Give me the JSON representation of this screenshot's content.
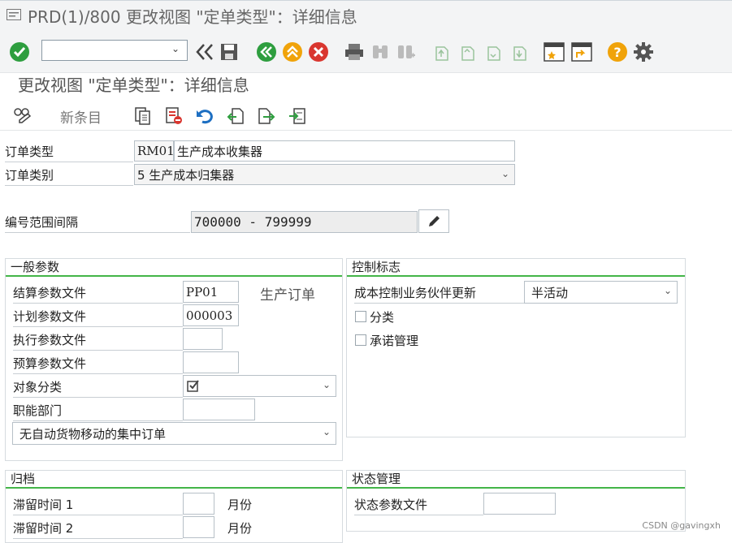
{
  "window": {
    "title": "PRD(1)/800 更改视图 \"定单类型\"：详细信息"
  },
  "toolbar": {
    "command_field_value": "",
    "icons": [
      "check-icon",
      "back-double-chevron-icon",
      "save-icon",
      "back-icon",
      "exit-icon",
      "cancel-icon",
      "print-icon",
      "find-icon",
      "find-next-icon",
      "first-page-icon",
      "prev-page-icon",
      "next-page-icon",
      "last-page-icon",
      "new-session-icon",
      "shortcut-icon",
      "help-icon",
      "settings-icon"
    ]
  },
  "page": {
    "title": "更改视图 \"定单类型\"：详细信息"
  },
  "app_toolbar": {
    "new_entries_label": "新条目"
  },
  "header_fields": {
    "order_type_label": "订单类型",
    "order_type_code": "RM01",
    "order_type_desc": "生产成本收集器",
    "order_category_label": "订单类别",
    "order_category_value": "5 生产成本归集器",
    "number_range_label": "编号范围间隔",
    "number_range_value": "700000 - 799999"
  },
  "general_params": {
    "title": "一般参数",
    "settlement_label": "结算参数文件",
    "settlement_value": "PP01",
    "settlement_note": "生产订单",
    "planning_label": "计划参数文件",
    "planning_value": "000003",
    "execution_label": "执行参数文件",
    "execution_value": "",
    "budget_label": "预算参数文件",
    "budget_value": "",
    "object_class_label": "对象分类",
    "functional_area_label": "职能部门",
    "functional_area_value": "",
    "goods_movement_value": "无自动货物移动的集中订单"
  },
  "control_indicators": {
    "title": "控制标志",
    "partner_update_label": "成本控制业务伙伴更新",
    "partner_update_value": "半活动",
    "classification_label": "分类",
    "commitment_label": "承诺管理"
  },
  "archiving": {
    "title": "归档",
    "residence1_label": "滞留时间 1",
    "residence2_label": "滞留时间 2",
    "unit_label": "月份"
  },
  "status_mgmt": {
    "title": "状态管理",
    "status_profile_label": "状态参数文件",
    "status_profile_value": ""
  },
  "watermark": "CSDN @gavingxh",
  "colors": {
    "accent_green": "#43b548",
    "check_green": "#2e9e3f",
    "cancel_red": "#d9362f",
    "warning_orange": "#f0a30a"
  }
}
